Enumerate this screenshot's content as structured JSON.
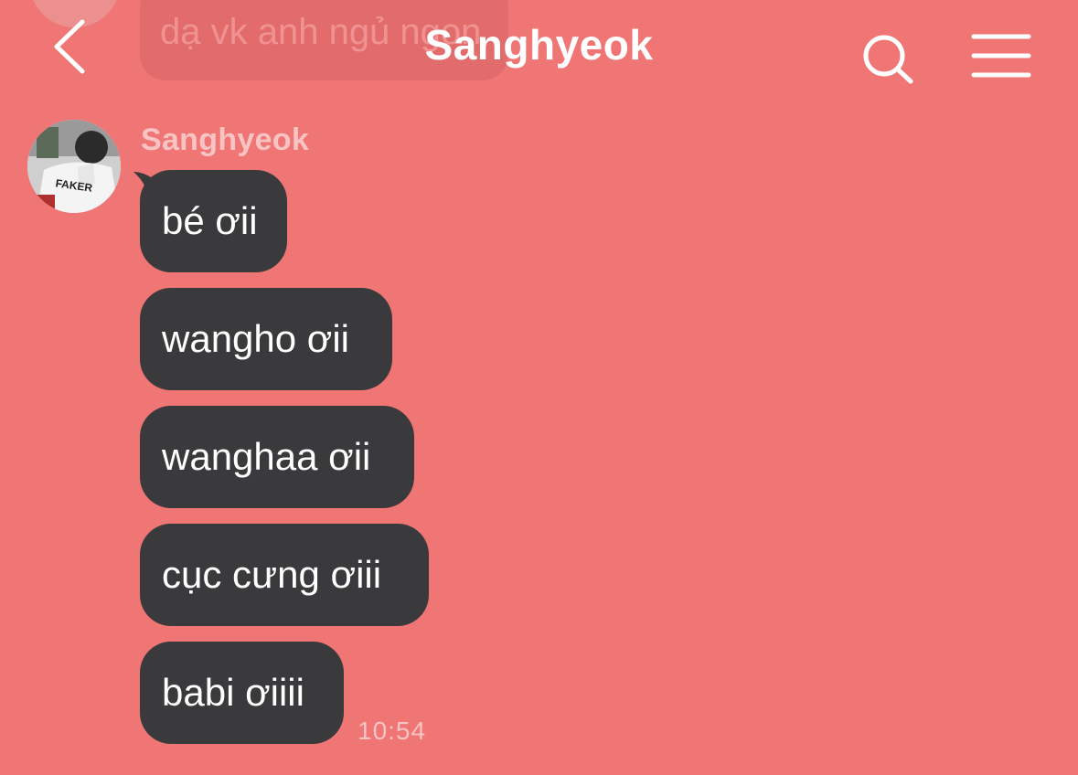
{
  "header": {
    "title": "Sanghyeok",
    "back_icon": "chevron-left-icon",
    "search_icon": "search-icon",
    "menu_icon": "hamburger-menu-icon"
  },
  "previous_message": {
    "text": "dạ vk anh ngủ ngon"
  },
  "chat": {
    "sender_name": "Sanghyeok",
    "avatar_text": "FAKER",
    "messages": [
      {
        "text": "bé ơii"
      },
      {
        "text": "wangho ơii"
      },
      {
        "text": "wanghaa ơii"
      },
      {
        "text": "cục cưng ơiii"
      },
      {
        "text": "babi ơiiii"
      }
    ],
    "last_timestamp": "10:54"
  },
  "colors": {
    "background": "#F07675",
    "bubble": "#3A3A3C",
    "text_light": "#F8C3C3",
    "text_white": "#FFFFFF"
  }
}
